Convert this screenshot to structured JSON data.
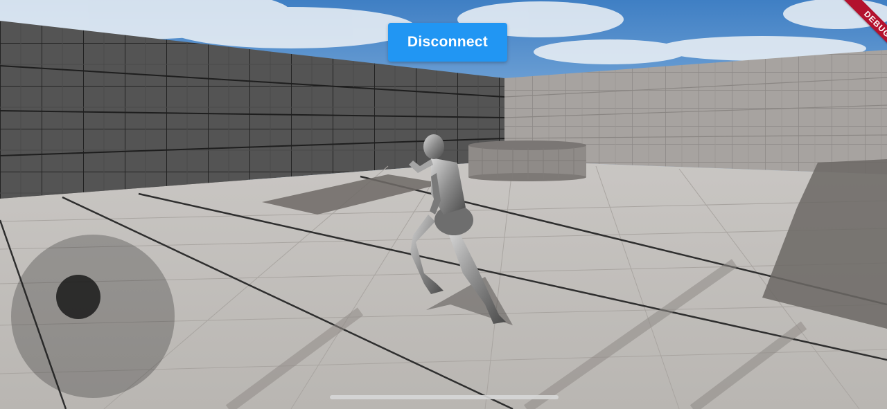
{
  "app": {
    "debug_label": "DEBUG"
  },
  "controls": {
    "disconnect_label": "Disconnect",
    "disconnect_color": "#2196F3"
  },
  "scene": {
    "character": "silver-mannequin-running",
    "environment": "grid-walled-arena"
  },
  "joystick": {
    "knob_offset_x": -0.25,
    "knob_offset_y": -0.33
  }
}
